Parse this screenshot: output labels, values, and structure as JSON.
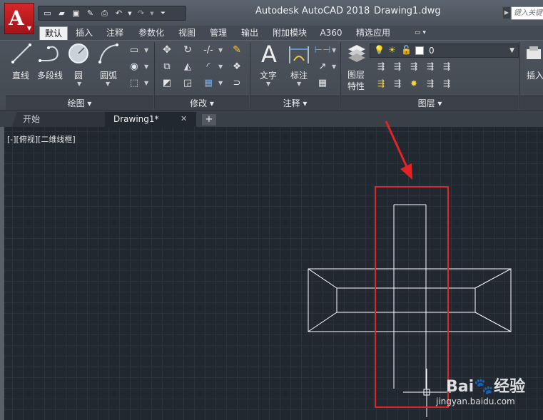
{
  "window": {
    "title": "Autodesk AutoCAD 2018",
    "document": "Drawing1.dwg",
    "app_letter": "A",
    "search_placeholder": "键入关键字"
  },
  "quick_access": [
    "new-icon",
    "open-icon",
    "save-icon",
    "saveas-icon",
    "print-icon",
    "undo-icon",
    "redo-icon",
    "dropdown-icon"
  ],
  "ribbon_tabs": [
    "默认",
    "插入",
    "注释",
    "参数化",
    "视图",
    "管理",
    "输出",
    "附加模块",
    "A360",
    "精选应用"
  ],
  "active_tab": "默认",
  "panels": {
    "draw": {
      "title": "绘图",
      "tools": [
        "直线",
        "多段线",
        "圆",
        "圆弧"
      ]
    },
    "modify": {
      "title": "修改"
    },
    "annotation": {
      "title": "注释",
      "tools": [
        "文字",
        "标注"
      ]
    },
    "layers": {
      "title": "图层",
      "tool": "图层\n特性",
      "tool_line1": "图层",
      "tool_line2": "特性",
      "current_layer": "0"
    },
    "insert": {
      "tool": "插入"
    }
  },
  "file_tabs": {
    "start": "开始",
    "active": "Drawing1*",
    "add": "+"
  },
  "viewport": {
    "label": "[-][俯视][二维线框]"
  },
  "colors": {
    "canvas_bg": "#212830",
    "highlight_box": "#e22424",
    "arrow": "#e22424",
    "linework": "#ffffff"
  },
  "watermark": {
    "brand_prefix": "Bai",
    "brand_suffix": "经验",
    "url": "jingyan.baidu.com"
  }
}
